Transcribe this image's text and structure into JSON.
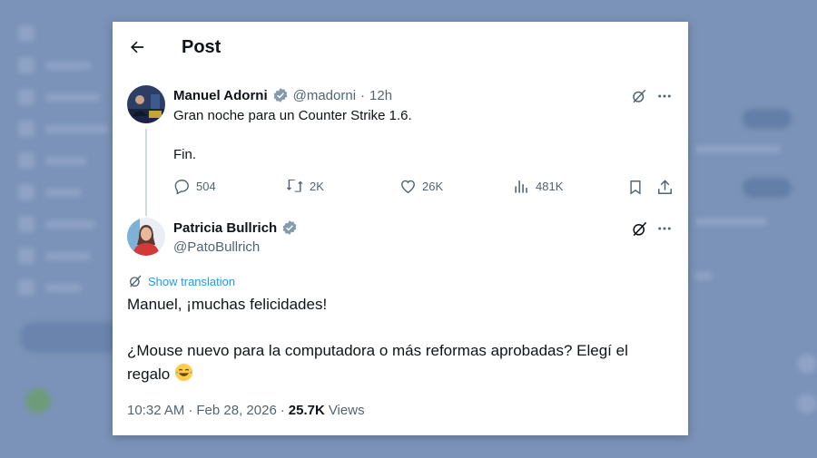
{
  "header": {
    "title": "Post"
  },
  "reply_to": {
    "name": "Manuel Adorni",
    "handle": "@madorni",
    "separator": "·",
    "time": "12h",
    "lines": [
      "Gran noche para un Counter Strike 1.6.",
      "Fin."
    ],
    "stats": {
      "replies": "504",
      "reposts": "2K",
      "likes": "26K",
      "views": "481K"
    }
  },
  "post": {
    "name": "Patricia Bullrich",
    "handle": "@PatoBullrich",
    "translate_label": "Show translation",
    "text_line1": "Manuel, ¡muchas felicidades!",
    "text_line2": "¿Mouse nuevo para la computadora o más reformas aprobadas? Elegí el",
    "text_line3": "regalo",
    "time": "10:32 AM",
    "date": "Feb 28, 2026",
    "separator": "·",
    "views_count": "25.7K",
    "views_label": "Views"
  },
  "colors": {
    "accent": "#1d9bf0",
    "muted": "#536471",
    "text": "#0f1419",
    "background": "#7b93b8"
  },
  "icons": [
    "back-arrow-icon",
    "verified-badge-icon",
    "grok-icon",
    "more-icon",
    "reply-icon",
    "repost-icon",
    "like-icon",
    "views-icon",
    "bookmark-icon",
    "share-icon",
    "translate-icon",
    "laughing-emoji-icon"
  ]
}
